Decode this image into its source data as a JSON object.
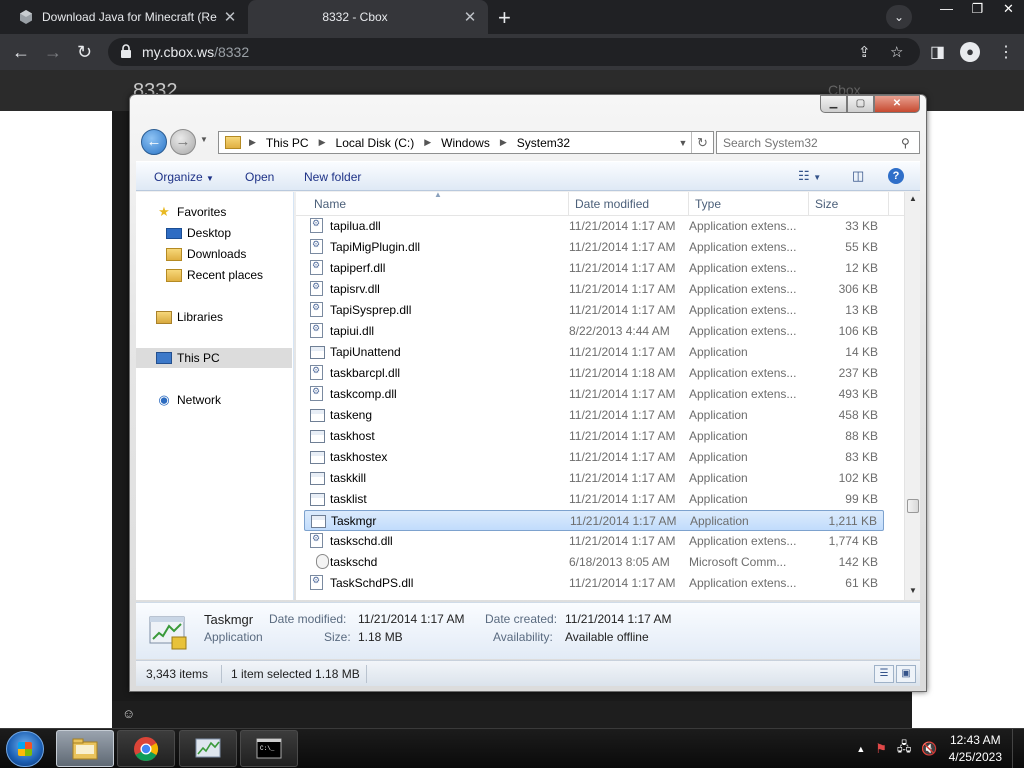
{
  "browser": {
    "tabs": [
      {
        "title": "Download Java for Minecraft (Re",
        "close": "✕"
      },
      {
        "title": "8332 - Cbox",
        "close": "✕"
      }
    ],
    "new_tab": "+",
    "url_host": "my.cbox.ws",
    "url_path": "/8332"
  },
  "page": {
    "title": "8332",
    "right_text": "Cbox",
    "smiley": "☺"
  },
  "explorer": {
    "breadcrumb": [
      "This PC",
      "Local Disk (C:)",
      "Windows",
      "System32"
    ],
    "search_placeholder": "Search System32",
    "commands": {
      "organize": "Organize",
      "open": "Open",
      "new_folder": "New folder"
    },
    "nav": {
      "favorites": "Favorites",
      "desktop": "Desktop",
      "downloads": "Downloads",
      "recent": "Recent places",
      "libraries": "Libraries",
      "this_pc": "This PC",
      "network": "Network"
    },
    "columns": {
      "name": "Name",
      "date": "Date modified",
      "type": "Type",
      "size": "Size"
    },
    "files": [
      {
        "name": "tapilua.dll",
        "date": "11/21/2014 1:17 AM",
        "type": "Application extens...",
        "size": "33 KB",
        "icon": "dll"
      },
      {
        "name": "TapiMigPlugin.dll",
        "date": "11/21/2014 1:17 AM",
        "type": "Application extens...",
        "size": "55 KB",
        "icon": "dll"
      },
      {
        "name": "tapiperf.dll",
        "date": "11/21/2014 1:17 AM",
        "type": "Application extens...",
        "size": "12 KB",
        "icon": "dll"
      },
      {
        "name": "tapisrv.dll",
        "date": "11/21/2014 1:17 AM",
        "type": "Application extens...",
        "size": "306 KB",
        "icon": "dll"
      },
      {
        "name": "TapiSysprep.dll",
        "date": "11/21/2014 1:17 AM",
        "type": "Application extens...",
        "size": "13 KB",
        "icon": "dll"
      },
      {
        "name": "tapiui.dll",
        "date": "8/22/2013 4:44 AM",
        "type": "Application extens...",
        "size": "106 KB",
        "icon": "dll"
      },
      {
        "name": "TapiUnattend",
        "date": "11/21/2014 1:17 AM",
        "type": "Application",
        "size": "14 KB",
        "icon": "app"
      },
      {
        "name": "taskbarcpl.dll",
        "date": "11/21/2014 1:18 AM",
        "type": "Application extens...",
        "size": "237 KB",
        "icon": "dll"
      },
      {
        "name": "taskcomp.dll",
        "date": "11/21/2014 1:17 AM",
        "type": "Application extens...",
        "size": "493 KB",
        "icon": "dll"
      },
      {
        "name": "taskeng",
        "date": "11/21/2014 1:17 AM",
        "type": "Application",
        "size": "458 KB",
        "icon": "app"
      },
      {
        "name": "taskhost",
        "date": "11/21/2014 1:17 AM",
        "type": "Application",
        "size": "88 KB",
        "icon": "app"
      },
      {
        "name": "taskhostex",
        "date": "11/21/2014 1:17 AM",
        "type": "Application",
        "size": "83 KB",
        "icon": "app"
      },
      {
        "name": "taskkill",
        "date": "11/21/2014 1:17 AM",
        "type": "Application",
        "size": "102 KB",
        "icon": "app"
      },
      {
        "name": "tasklist",
        "date": "11/21/2014 1:17 AM",
        "type": "Application",
        "size": "99 KB",
        "icon": "app"
      },
      {
        "name": "Taskmgr",
        "date": "11/21/2014 1:17 AM",
        "type": "Application",
        "size": "1,211 KB",
        "icon": "app",
        "selected": true
      },
      {
        "name": "taskschd.dll",
        "date": "11/21/2014 1:17 AM",
        "type": "Application extens...",
        "size": "1,774 KB",
        "icon": "dll"
      },
      {
        "name": "taskschd",
        "date": "6/18/2013 8:05 AM",
        "type": "Microsoft Comm...",
        "size": "142 KB",
        "icon": "clock"
      },
      {
        "name": "TaskSchdPS.dll",
        "date": "11/21/2014 1:17 AM",
        "type": "Application extens...",
        "size": "61 KB",
        "icon": "dll"
      }
    ],
    "details": {
      "name": "Taskmgr",
      "kind": "Application",
      "date_modified_label": "Date modified:",
      "date_modified": "11/21/2014 1:17 AM",
      "size_label": "Size:",
      "size": "1.18 MB",
      "date_created_label": "Date created:",
      "date_created": "11/21/2014 1:17 AM",
      "availability_label": "Availability:",
      "availability": "Available offline"
    },
    "status": {
      "items": "3,343 items",
      "selected": "1 item selected  1.18 MB"
    }
  },
  "taskbar": {
    "clock_time": "12:43 AM",
    "clock_date": "4/25/2023",
    "tray_arrow": "▲"
  },
  "colors": {
    "chrome_dark": "#202124",
    "chrome_toolbar": "#35363a",
    "explorer_link": "#1e3287",
    "selection": "#c1dcfc"
  }
}
